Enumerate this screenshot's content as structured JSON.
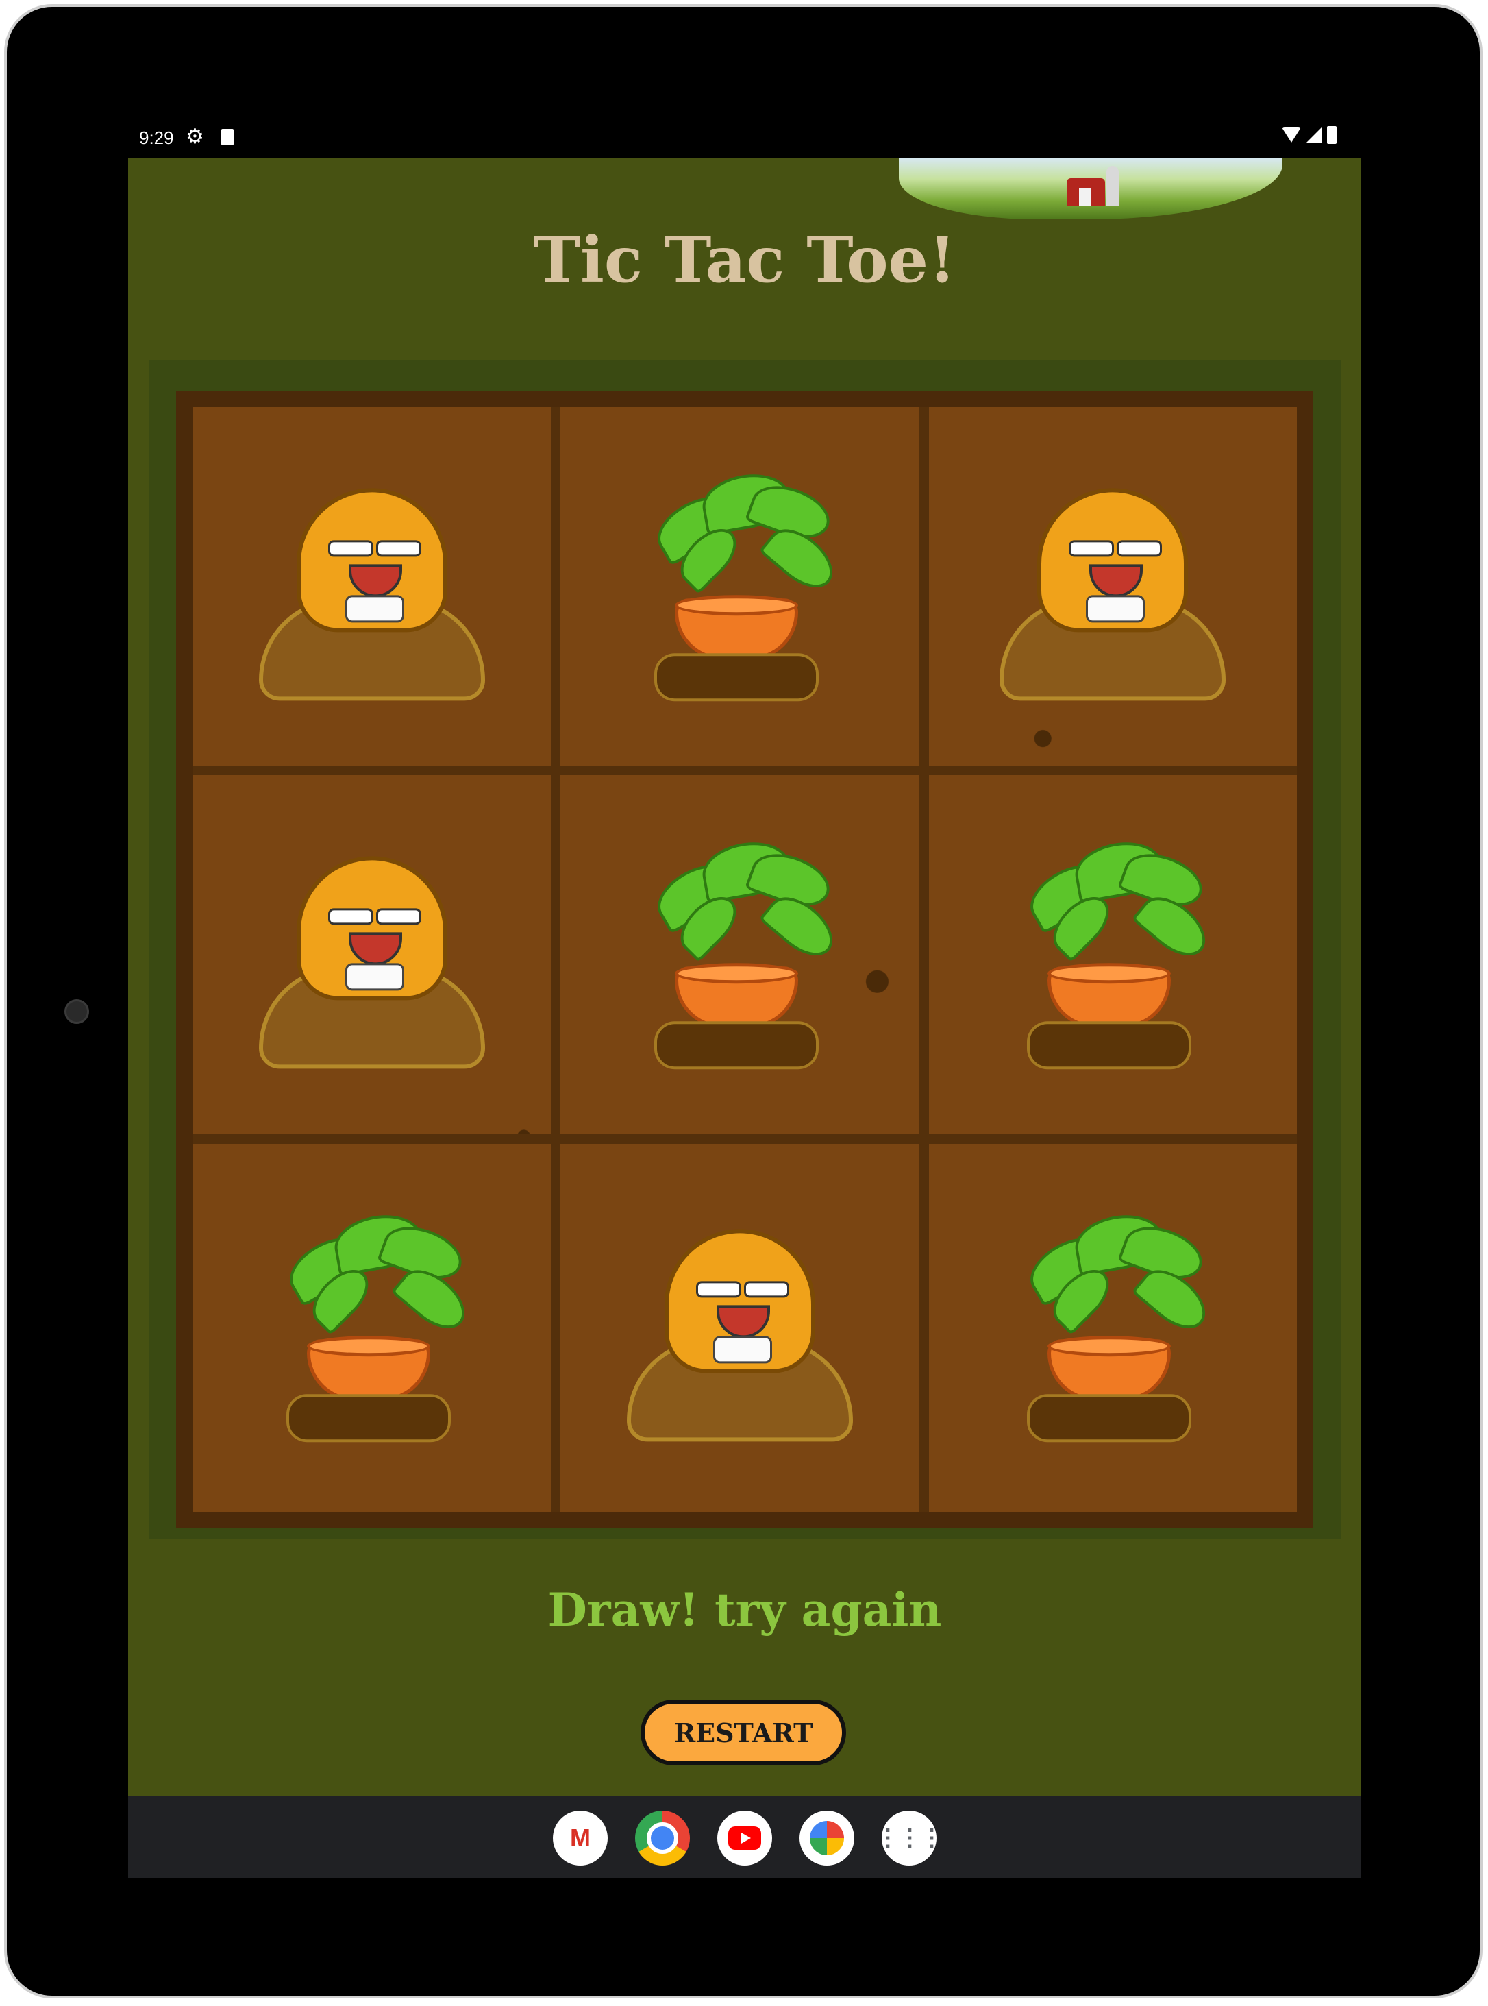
{
  "status_bar": {
    "time": "9:29"
  },
  "app": {
    "title": "Tic Tac Toe!",
    "board": [
      [
        "mole",
        "carrot",
        "mole"
      ],
      [
        "mole",
        "carrot",
        "carrot"
      ],
      [
        "carrot",
        "mole",
        "carrot"
      ]
    ],
    "result_text": "Draw! try again",
    "restart_label": "RESTART"
  },
  "taskbar": {
    "apps": [
      "gmail-icon",
      "chrome-icon",
      "youtube-icon",
      "photos-icon",
      "app-drawer-icon"
    ]
  },
  "colors": {
    "background": "#475212",
    "title": "#d8c3a0",
    "result": "#8cc63f",
    "restart_button": "#fba83e"
  }
}
